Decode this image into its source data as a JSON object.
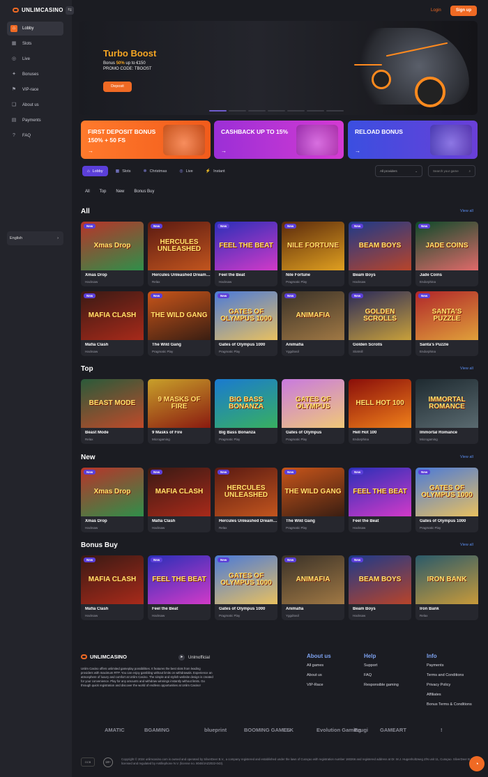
{
  "brand": {
    "name": "UNLIMCASINO"
  },
  "topbar": {
    "login": "Login",
    "signup": "Sign up"
  },
  "sidebar": {
    "items": [
      {
        "label": "Lobby",
        "icon": "⌂"
      },
      {
        "label": "Slots",
        "icon": "▦"
      },
      {
        "label": "Live",
        "icon": "◎"
      },
      {
        "label": "Bonuses",
        "icon": "✦"
      },
      {
        "label": "VIP-race",
        "icon": "⚑"
      },
      {
        "label": "About us",
        "icon": "❑"
      },
      {
        "label": "Payments",
        "icon": "▤"
      },
      {
        "label": "FAQ",
        "icon": "?"
      }
    ],
    "language": "English"
  },
  "hero": {
    "title": "Turbo Boost",
    "line1_prefix": "Bonus ",
    "line1_highlight": "50%",
    "line1_suffix": " up to €150",
    "line2": "PROMO CODE: TBOOST",
    "button": "Deposit",
    "active_slide": 1,
    "slide_count": 7
  },
  "promos": [
    {
      "title": "FIRST DEPOSIT BONUS 150% + 50 FS",
      "color_a": "#ff7a2c",
      "color_b": "#f25b1b"
    },
    {
      "title": "CASHBACK UP TO 15%",
      "color_a": "#9b2fd6",
      "color_b": "#d43ad3"
    },
    {
      "title": "RELOAD BONUS",
      "color_a": "#3b4fe0",
      "color_b": "#6a3fd8"
    }
  ],
  "tabs": [
    {
      "label": "Lobby",
      "icon": "⌂"
    },
    {
      "label": "Slots",
      "icon": "▦"
    },
    {
      "label": "Christmas",
      "icon": "❄"
    },
    {
      "label": "Live",
      "icon": "◎"
    },
    {
      "label": "Instant",
      "icon": "⚡"
    }
  ],
  "providers_select": "All providers",
  "search_placeholder": "Search your game",
  "filters": [
    "All",
    "Top",
    "New",
    "Bonus Buy"
  ],
  "view_all": "View all",
  "new_badge": "New",
  "sections": [
    {
      "title": "All",
      "games": [
        {
          "name": "Xmas Drop",
          "provider": "Hacksaw",
          "thumb": "Xmas Drop",
          "new": true,
          "bg": "#b8342a",
          "bg2": "#2f8f4a"
        },
        {
          "name": "Hercules Unleashed Dream Drop",
          "provider": "Relax",
          "thumb": "HERCULES UNLEASHED",
          "new": true,
          "bg": "#5a1a12",
          "bg2": "#c2551e"
        },
        {
          "name": "Feel the Beat",
          "provider": "Hacksaw",
          "thumb": "FEEL THE BEAT",
          "new": true,
          "bg": "#2a2fb8",
          "bg2": "#d23ac8"
        },
        {
          "name": "Nile Fortune",
          "provider": "Pragmatic Play",
          "thumb": "NILE FORTUNE",
          "new": true,
          "bg": "#5b2a0c",
          "bg2": "#e0a020"
        },
        {
          "name": "Beam Boys",
          "provider": "Hacksaw",
          "thumb": "BEAM BOYS",
          "new": true,
          "bg": "#1d3a8a",
          "bg2": "#b8442a"
        },
        {
          "name": "Jade Coins",
          "provider": "Endorphina",
          "thumb": "JADE COINS",
          "new": true,
          "bg": "#0e4a2a",
          "bg2": "#e06a6a"
        },
        {
          "name": "Mafia Clash",
          "provider": "Hacksaw",
          "thumb": "MAFIA CLASH",
          "new": true,
          "bg": "#3a1a14",
          "bg2": "#a82a1a"
        },
        {
          "name": "The Wild Gang",
          "provider": "Pragmatic Play",
          "thumb": "THE WILD GANG",
          "new": true,
          "bg": "#c8551a",
          "bg2": "#3a1e12"
        },
        {
          "name": "Gates of Olympus 1000",
          "provider": "Pragmatic Play",
          "thumb": "GATES OF OLYMPUS 1000",
          "new": true,
          "bg": "#4b7ad8",
          "bg2": "#e8c060"
        },
        {
          "name": "Animafia",
          "provider": "Yggdrasil",
          "thumb": "ANIMAFIA",
          "new": true,
          "bg": "#3a3228",
          "bg2": "#a07844"
        },
        {
          "name": "Golden Scrolls",
          "provider": "Slotmill",
          "thumb": "GOLDEN SCROLLS",
          "new": true,
          "bg": "#2a2a5a",
          "bg2": "#c8a03a"
        },
        {
          "name": "Santa's Puzzle",
          "provider": "Endorphina",
          "thumb": "SANTA'S PUZZLE",
          "new": true,
          "bg": "#b0262a",
          "bg2": "#e0a03a"
        }
      ]
    },
    {
      "title": "Top",
      "games": [
        {
          "name": "Beast Mode",
          "provider": "Relax",
          "thumb": "BEAST MODE",
          "new": false,
          "bg": "#2a5a3a",
          "bg2": "#c04a2a"
        },
        {
          "name": "9 Masks of Fire",
          "provider": "Microgaming",
          "thumb": "9 MASKS OF FIRE",
          "new": false,
          "bg": "#c8a02a",
          "bg2": "#8a1a10"
        },
        {
          "name": "Big Bass Bonanza",
          "provider": "Pragmatic Play",
          "thumb": "BIG BASS BONANZA",
          "new": false,
          "bg": "#1a7ad0",
          "bg2": "#38b060"
        },
        {
          "name": "Gates of Olympus",
          "provider": "Pragmatic Play",
          "thumb": "GATES OF OLYMPUS",
          "new": false,
          "bg": "#c87adf",
          "bg2": "#f0c878"
        },
        {
          "name": "Hell Hot 100",
          "provider": "Endorphina",
          "thumb": "HELL HOT 100",
          "new": false,
          "bg": "#8a0e0a",
          "bg2": "#f0801a"
        },
        {
          "name": "Immortal Romance",
          "provider": "Microgaming",
          "thumb": "IMMORTAL ROMANCE",
          "new": false,
          "bg": "#1e2a30",
          "bg2": "#5a6a70"
        }
      ]
    },
    {
      "title": "New",
      "games": [
        {
          "name": "Xmas Drop",
          "provider": "Hacksaw",
          "thumb": "Xmas Drop",
          "new": true,
          "bg": "#b8342a",
          "bg2": "#2f8f4a"
        },
        {
          "name": "Mafia Clash",
          "provider": "Hacksaw",
          "thumb": "MAFIA CLASH",
          "new": true,
          "bg": "#3a1a14",
          "bg2": "#a82a1a"
        },
        {
          "name": "Hercules Unleashed Dream Drop",
          "provider": "Relax",
          "thumb": "HERCULES UNLEASHED",
          "new": true,
          "bg": "#5a1a12",
          "bg2": "#c2551e"
        },
        {
          "name": "The Wild Gang",
          "provider": "Pragmatic Play",
          "thumb": "THE WILD GANG",
          "new": true,
          "bg": "#c8551a",
          "bg2": "#3a1e12"
        },
        {
          "name": "Feel the Beat",
          "provider": "Hacksaw",
          "thumb": "FEEL THE BEAT",
          "new": true,
          "bg": "#2a2fb8",
          "bg2": "#d23ac8"
        },
        {
          "name": "Gates of Olympus 1000",
          "provider": "Pragmatic Play",
          "thumb": "GATES OF OLYMPUS 1000",
          "new": true,
          "bg": "#4b7ad8",
          "bg2": "#e8c060"
        }
      ]
    },
    {
      "title": "Bonus Buy",
      "games": [
        {
          "name": "Mafia Clash",
          "provider": "Hacksaw",
          "thumb": "MAFIA CLASH",
          "new": true,
          "bg": "#3a1a14",
          "bg2": "#a82a1a"
        },
        {
          "name": "Feel the Beat",
          "provider": "Hacksaw",
          "thumb": "FEEL THE BEAT",
          "new": true,
          "bg": "#2a2fb8",
          "bg2": "#d23ac8"
        },
        {
          "name": "Gates of Olympus 1000",
          "provider": "Pragmatic Play",
          "thumb": "GATES OF OLYMPUS 1000",
          "new": true,
          "bg": "#4b7ad8",
          "bg2": "#e8c060"
        },
        {
          "name": "Animafia",
          "provider": "Yggdrasil",
          "thumb": "ANIMAFIA",
          "new": true,
          "bg": "#3a3228",
          "bg2": "#a07844"
        },
        {
          "name": "Beam Boys",
          "provider": "Hacksaw",
          "thumb": "BEAM BOYS",
          "new": true,
          "bg": "#1d3a8a",
          "bg2": "#b8442a"
        },
        {
          "name": "Iron Bank",
          "provider": "Relax",
          "thumb": "IRON BANK",
          "new": false,
          "bg": "#2a5a6a",
          "bg2": "#c89a3a"
        }
      ]
    }
  ],
  "footer": {
    "telegram": "Unlmofficial",
    "description": "Unlim Casino offers unlimited gameplay possibilities. It features the best slots from leading providers with maximum RTP. You can enjoy gambling without limits on withdrawals. Experience an atmosphere of luxury and comfort at Unlim Casino. The simple and stylish website design is created for your convenience. Play for any amounts and withdraw winnings instantly without limits. Go through quick registration and discover the world of endless opportunities at Unlim Casino!",
    "columns": [
      {
        "title": "About us",
        "links": [
          "All games",
          "About us",
          "VIP-Race"
        ]
      },
      {
        "title": "Help",
        "links": [
          "Support",
          "FAQ",
          "Responsible gaming"
        ]
      },
      {
        "title": "Info",
        "links": [
          "Payments",
          "Terms and Conditions",
          "Privacy Policy",
          "Affiliates",
          "Bonus Terms & Conditions"
        ]
      }
    ],
    "providers": [
      "AMATIC",
      "BGAMING",
      "blueprint",
      "BOOMING GAMES",
      "ELK",
      "Evolution Gaming",
      "Ezugi",
      "GAMEART",
      "!"
    ],
    "age": "18+",
    "copyright": "Copyright © 2024 unlimcasino.com is owned and operated by SilverDeer B.V., a company registered and established under the laws of Curaçao with registration number 160266 and registered address at Dr. M.J. Hugenholtzweg Z/N unit 11, Curaçao. SilverDeer B.V. is licensed and regulated by Antillephone N.V. (license no. 8048/JAZ2022-043)."
  }
}
